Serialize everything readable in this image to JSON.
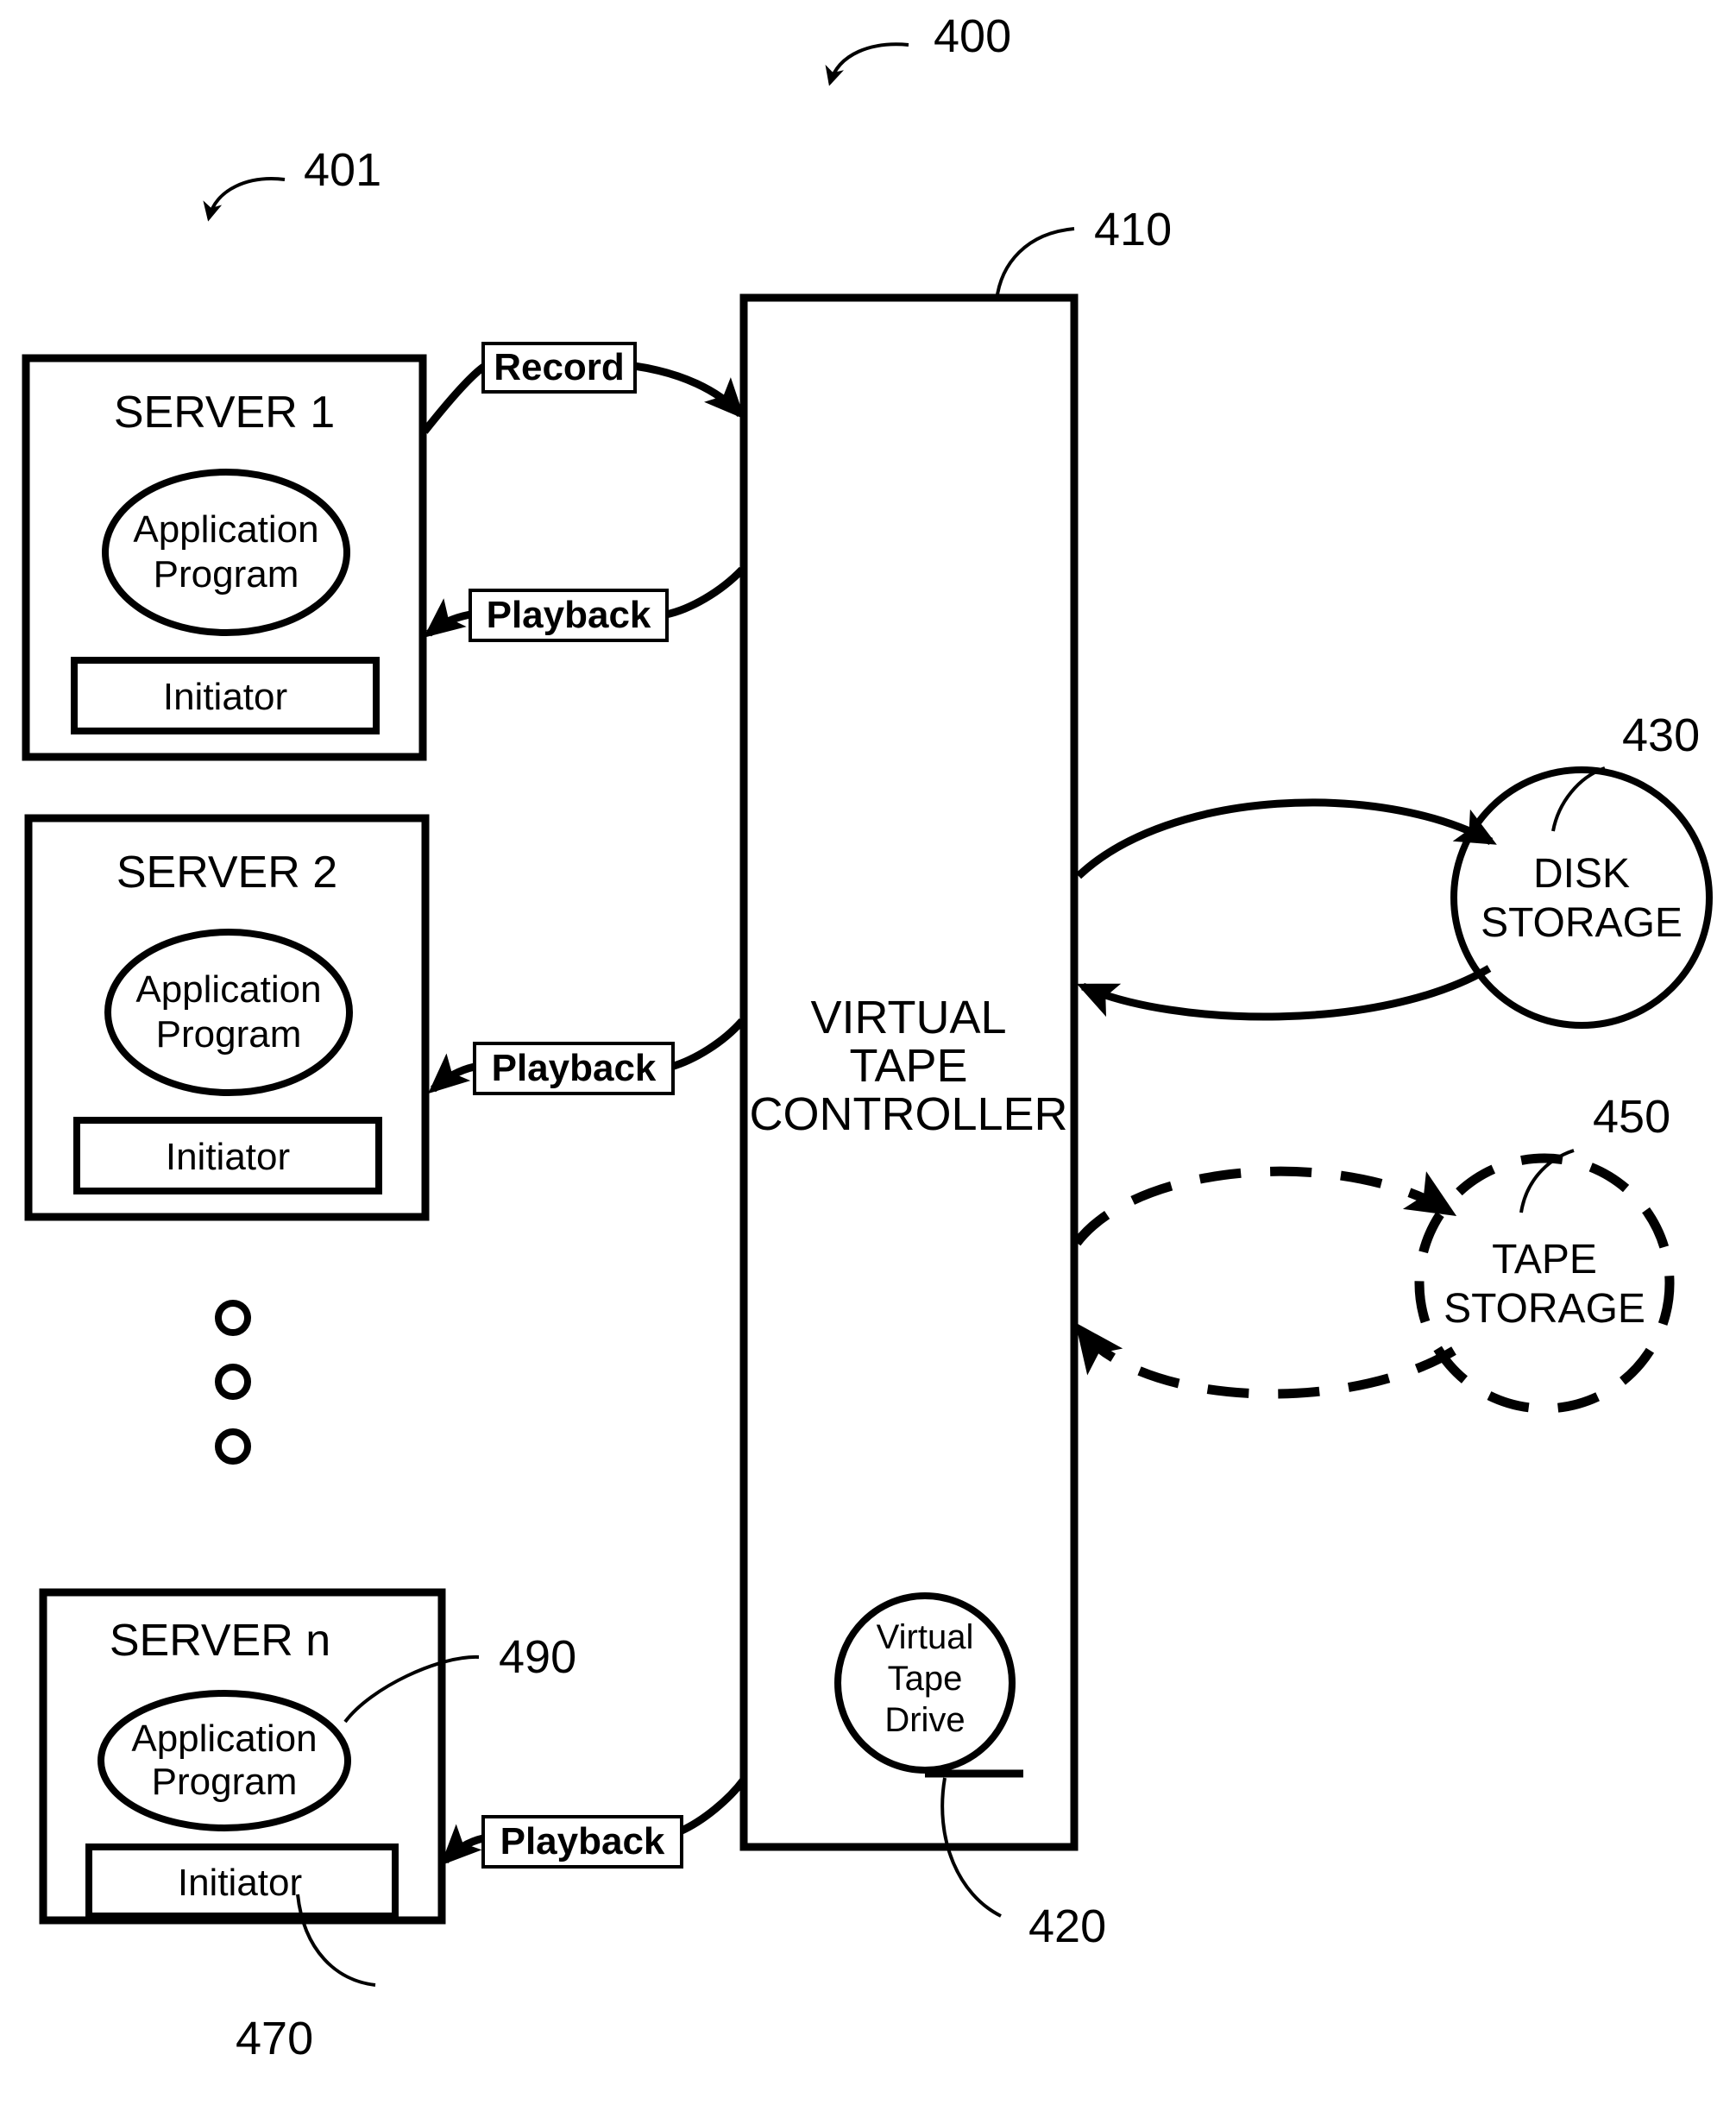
{
  "figure": {
    "ref_main": "400",
    "ref_servers_group": "401"
  },
  "servers": [
    {
      "title": "SERVER 1",
      "oval_line1": "Application",
      "oval_line2": "Program",
      "initiator": "Initiator"
    },
    {
      "title": "SERVER 2",
      "oval_line1": "Application",
      "oval_line2": "Program",
      "initiator": "Initiator"
    },
    {
      "title": "SERVER n",
      "oval_line1": "Application",
      "oval_line2": "Program",
      "initiator": "Initiator"
    }
  ],
  "controller": {
    "ref": "410",
    "line1": "VIRTUAL",
    "line2": "TAPE",
    "line3": "CONTROLLER",
    "virtual_tape_drive": {
      "ref": "420",
      "line1": "Virtual",
      "line2": "Tape",
      "line3": "Drive"
    }
  },
  "storage": [
    {
      "ref": "430",
      "line1": "DISK",
      "line2": "STORAGE",
      "style": "solid"
    },
    {
      "ref": "450",
      "line1": "TAPE",
      "line2": "STORAGE",
      "style": "dashed"
    }
  ],
  "flows": {
    "record": "Record",
    "playback": "Playback"
  },
  "callouts": {
    "application_program_ref": "490",
    "initiator_ref": "470"
  },
  "colors": {
    "ink": "#000000",
    "paper": "#ffffff"
  }
}
